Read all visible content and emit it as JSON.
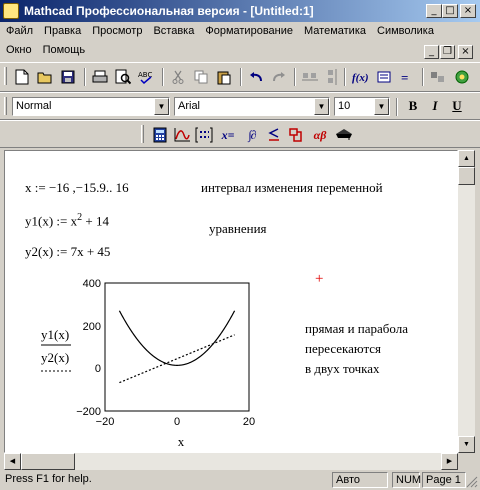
{
  "window": {
    "title": "Mathcad Профессиональная версия - [Untitled:1]"
  },
  "menu": {
    "row1": [
      "Файл",
      "Правка",
      "Просмотр",
      "Вставка",
      "Форматирование",
      "Математика",
      "Символика"
    ],
    "row2": [
      "Окно",
      "Помощь"
    ]
  },
  "format": {
    "style": "Normal",
    "font": "Arial",
    "size": "10",
    "bold": "B",
    "italic": "I",
    "underline": "U"
  },
  "math_toolbar": {
    "calculus_label": "∫∂",
    "greek_label": "αβ",
    "eval_label": "x="
  },
  "worksheet": {
    "range_def": "x := −16 ,−15.9.. 16",
    "range_comment": "интервал изменения переменной",
    "y1_lhs": "y1(x) := x",
    "y1_exp": "2",
    "y1_rhs": "+ 14",
    "y2_def": "y2(x) := 7x + 45",
    "equations_label": "уравнения",
    "plot_label_y1": "y1(x)",
    "plot_label_y2": "y2(x)",
    "plot_label_x": "x",
    "y_ticks": [
      "400",
      "200",
      "0",
      "−200"
    ],
    "x_ticks": [
      "−20",
      "0",
      "20"
    ],
    "note_line1": "прямая и парабола",
    "note_line2": "пересекаются",
    "note_line3": "в двух точках",
    "cursor": "+"
  },
  "chart_data": {
    "type": "line",
    "x_range": [
      -16,
      16
    ],
    "step": 0.1,
    "xlim": [
      -20,
      20
    ],
    "ylim": [
      -200,
      400
    ],
    "series": [
      {
        "expression": "x^2 + 14",
        "style": "solid",
        "color": "#000000"
      },
      {
        "expression": "7x + 45",
        "style": "dotted",
        "color": "#000000"
      }
    ]
  },
  "status": {
    "help": "Press F1 for help.",
    "mode": "Авто",
    "num": "NUM",
    "page": "Page 1"
  }
}
